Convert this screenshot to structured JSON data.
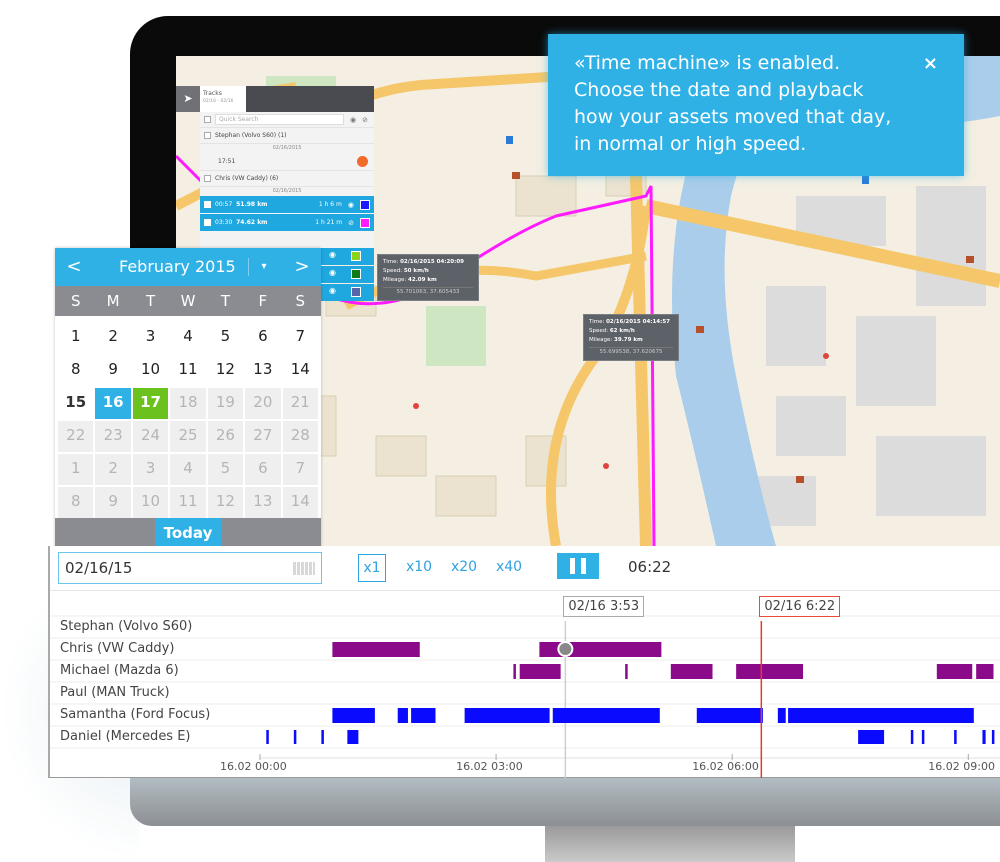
{
  "notice": {
    "text_lines": [
      "«Time machine» is enabled.",
      "Choose the date and playback",
      "how your assets moved that day,",
      "in normal or high speed."
    ],
    "close_glyph": "×"
  },
  "tracks_panel": {
    "nav_glyph": "➤",
    "tab_label": "Tracks",
    "tab_sublabel": "02/16 - 02/16",
    "search_placeholder": "Quick Search",
    "rows": [
      {
        "type": "unit",
        "label": "Stephan (Volvo S60) (1)"
      },
      {
        "type": "date",
        "label": "02/16/2015"
      },
      {
        "type": "note",
        "label": "17:51"
      },
      {
        "type": "unit",
        "label": "Chris (VW Caddy) (6)"
      },
      {
        "type": "date",
        "label": "02/16/2015"
      }
    ],
    "tracks": [
      {
        "time": "00:57",
        "distance": "51.98 km",
        "duration": "1 h 6 m",
        "color": "#1a1aff"
      },
      {
        "time": "03:30",
        "distance": "74.62 km",
        "duration": "1 h 21 m",
        "color": "#ff1aff"
      },
      {
        "time": "",
        "distance": "",
        "duration": "",
        "color": "#8fd01f"
      },
      {
        "time": "",
        "distance": "",
        "duration": "",
        "color": "#0f7a1a"
      },
      {
        "time": "",
        "distance": "",
        "duration": "",
        "color": "#5566aa"
      }
    ]
  },
  "map_popups": [
    {
      "time_label": "Time",
      "time": "02/16/2015 04:20:09",
      "speed_label": "Speed",
      "speed": "50 km/h",
      "mileage_label": "Mileage",
      "mileage": "42.09 km",
      "coords": "55.701063, 37.605433"
    },
    {
      "time_label": "Time",
      "time": "02/16/2015 04:14:57",
      "speed_label": "Speed",
      "speed": "62 km/h",
      "mileage_label": "Mileage",
      "mileage": "39.79 km",
      "coords": "55.699538, 37.620675"
    }
  ],
  "calendar": {
    "month_title": "February 2015",
    "prev_glyph": "<",
    "next_glyph": ">",
    "dropdown_glyph": "▾",
    "weekdays": [
      "S",
      "M",
      "T",
      "W",
      "T",
      "F",
      "S"
    ],
    "days": [
      {
        "d": "1",
        "s": "n"
      },
      {
        "d": "2",
        "s": "n"
      },
      {
        "d": "3",
        "s": "n"
      },
      {
        "d": "4",
        "s": "n"
      },
      {
        "d": "5",
        "s": "n"
      },
      {
        "d": "6",
        "s": "n"
      },
      {
        "d": "7",
        "s": "n"
      },
      {
        "d": "8",
        "s": "n"
      },
      {
        "d": "9",
        "s": "n"
      },
      {
        "d": "10",
        "s": "n"
      },
      {
        "d": "11",
        "s": "n"
      },
      {
        "d": "12",
        "s": "n"
      },
      {
        "d": "13",
        "s": "n"
      },
      {
        "d": "14",
        "s": "n"
      },
      {
        "d": "15",
        "s": "bold"
      },
      {
        "d": "16",
        "s": "selected"
      },
      {
        "d": "17",
        "s": "today"
      },
      {
        "d": "18",
        "s": "disabled"
      },
      {
        "d": "19",
        "s": "disabled"
      },
      {
        "d": "20",
        "s": "disabled"
      },
      {
        "d": "21",
        "s": "disabled"
      },
      {
        "d": "22",
        "s": "disabled"
      },
      {
        "d": "23",
        "s": "disabled"
      },
      {
        "d": "24",
        "s": "disabled"
      },
      {
        "d": "25",
        "s": "disabled"
      },
      {
        "d": "26",
        "s": "disabled"
      },
      {
        "d": "27",
        "s": "disabled"
      },
      {
        "d": "28",
        "s": "disabled"
      },
      {
        "d": "1",
        "s": "disabled"
      },
      {
        "d": "2",
        "s": "disabled"
      },
      {
        "d": "3",
        "s": "disabled"
      },
      {
        "d": "4",
        "s": "disabled"
      },
      {
        "d": "5",
        "s": "disabled"
      },
      {
        "d": "6",
        "s": "disabled"
      },
      {
        "d": "7",
        "s": "disabled"
      },
      {
        "d": "8",
        "s": "disabled"
      },
      {
        "d": "9",
        "s": "disabled"
      },
      {
        "d": "10",
        "s": "disabled"
      },
      {
        "d": "11",
        "s": "disabled"
      },
      {
        "d": "12",
        "s": "disabled"
      },
      {
        "d": "13",
        "s": "disabled"
      },
      {
        "d": "14",
        "s": "disabled"
      }
    ],
    "today_label": "Today"
  },
  "timeline": {
    "date_value": "02/16/15",
    "speeds": [
      {
        "label": "x1",
        "active": true
      },
      {
        "label": "x10",
        "active": false
      },
      {
        "label": "x20",
        "active": false
      },
      {
        "label": "x40",
        "active": false
      }
    ],
    "play_time": "06:22",
    "hover_label": "02/16 3:53",
    "current_label": "02/16 6:22",
    "hover_hour": 3.88,
    "current_hour": 6.37,
    "axis_ticks": [
      {
        "hour": 0,
        "label": "16.02 00:00"
      },
      {
        "hour": 3,
        "label": "16.02 03:00"
      },
      {
        "hour": 6,
        "label": "16.02 06:00"
      },
      {
        "hour": 9,
        "label": "16.02 09:00"
      }
    ],
    "colors": {
      "purple": "#8a0a8a",
      "blue": "#0a0aff",
      "cursor": "#e53935",
      "hover": "#cfcfcf"
    },
    "rows": [
      {
        "name": "Stephan (Volvo S60)",
        "color": "purple",
        "segments": []
      },
      {
        "name": "Chris (VW Caddy)",
        "color": "purple",
        "segments": [
          [
            0.92,
            2.03
          ],
          [
            3.55,
            5.1
          ]
        ]
      },
      {
        "name": "Michael (Mazda 6)",
        "color": "purple",
        "segments": [
          [
            3.22,
            3.24
          ],
          [
            3.3,
            3.82
          ],
          [
            4.64,
            4.66
          ],
          [
            5.22,
            5.75
          ],
          [
            6.05,
            6.9
          ],
          [
            8.6,
            9.05
          ],
          [
            9.1,
            9.32
          ]
        ]
      },
      {
        "name": "Paul (MAN Truck)",
        "color": "purple",
        "segments": []
      },
      {
        "name": "Samantha (Ford Focus)",
        "color": "blue",
        "segments": [
          [
            0.92,
            1.46
          ],
          [
            1.75,
            1.88
          ],
          [
            1.92,
            2.23
          ],
          [
            2.6,
            3.68
          ],
          [
            3.72,
            5.08
          ],
          [
            5.55,
            6.39
          ],
          [
            6.58,
            6.68
          ],
          [
            6.71,
            9.07
          ]
        ]
      },
      {
        "name": "Daniel (Mercedes E)",
        "color": "blue",
        "segments": [
          [
            0.08,
            0.11
          ],
          [
            0.43,
            0.46
          ],
          [
            0.78,
            0.81
          ],
          [
            1.11,
            1.25
          ],
          [
            7.6,
            7.93
          ],
          [
            8.27,
            8.3
          ],
          [
            8.41,
            8.44
          ],
          [
            8.82,
            8.85
          ],
          [
            9.18,
            9.22
          ],
          [
            9.3,
            9.33
          ]
        ]
      }
    ]
  }
}
